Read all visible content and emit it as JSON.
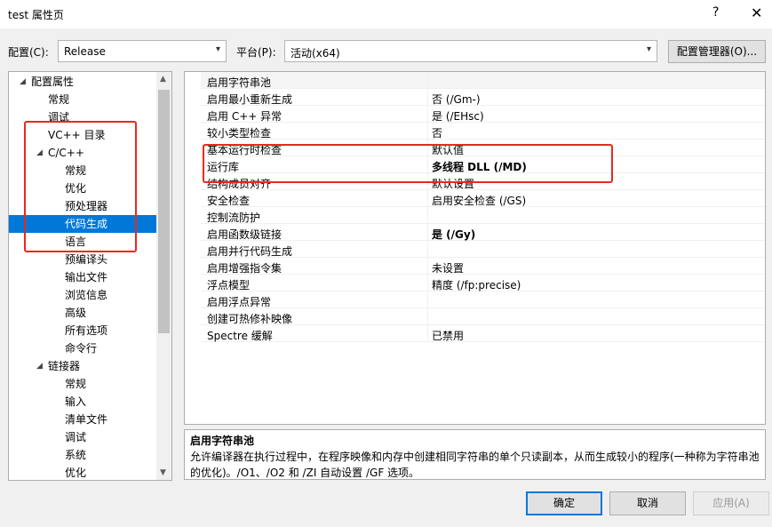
{
  "window": {
    "title": "test 属性页",
    "help_glyph": "?",
    "close_glyph": "✕"
  },
  "toolbar": {
    "config_label": "配置(C):",
    "config_value": "Release",
    "platform_label": "平台(P):",
    "platform_value": "活动(x64)",
    "config_manager_button": "配置管理器(O)..."
  },
  "tree": {
    "items": [
      {
        "label": "配置属性",
        "level": 0,
        "expander": "◢"
      },
      {
        "label": "常规",
        "level": 1
      },
      {
        "label": "调试",
        "level": 1
      },
      {
        "label": "VC++ 目录",
        "level": 1
      },
      {
        "label": "C/C++",
        "level": 1,
        "expander": "◢"
      },
      {
        "label": "常规",
        "level": 2
      },
      {
        "label": "优化",
        "level": 2
      },
      {
        "label": "预处理器",
        "level": 2
      },
      {
        "label": "代码生成",
        "level": 2,
        "selected": true
      },
      {
        "label": "语言",
        "level": 2
      },
      {
        "label": "预编译头",
        "level": 2
      },
      {
        "label": "输出文件",
        "level": 2
      },
      {
        "label": "浏览信息",
        "level": 2
      },
      {
        "label": "高级",
        "level": 2
      },
      {
        "label": "所有选项",
        "level": 2
      },
      {
        "label": "命令行",
        "level": 2
      },
      {
        "label": "链接器",
        "level": 1,
        "expander": "◢"
      },
      {
        "label": "常规",
        "level": 2
      },
      {
        "label": "输入",
        "level": 2
      },
      {
        "label": "清单文件",
        "level": 2
      },
      {
        "label": "调试",
        "level": 2
      },
      {
        "label": "系统",
        "level": 2
      },
      {
        "label": "优化",
        "level": 2
      }
    ]
  },
  "grid": {
    "rows": [
      {
        "name": "启用字符串池",
        "value": ""
      },
      {
        "name": "启用最小重新生成",
        "value": "否 (/Gm-)"
      },
      {
        "name": "启用 C++ 异常",
        "value": "是 (/EHsc)"
      },
      {
        "name": "较小类型检查",
        "value": "否"
      },
      {
        "name": "基本运行时检查",
        "value": "默认值"
      },
      {
        "name": "运行库",
        "value": "多线程 DLL (/MD)",
        "bold": true
      },
      {
        "name": "结构成员对齐",
        "value": "默认设置"
      },
      {
        "name": "安全检查",
        "value": "启用安全检查 (/GS)"
      },
      {
        "name": "控制流防护",
        "value": ""
      },
      {
        "name": "启用函数级链接",
        "value": "是 (/Gy)",
        "bold": true
      },
      {
        "name": "启用并行代码生成",
        "value": ""
      },
      {
        "name": "启用增强指令集",
        "value": "未设置"
      },
      {
        "name": "浮点模型",
        "value": "精度 (/fp:precise)"
      },
      {
        "name": "启用浮点异常",
        "value": ""
      },
      {
        "name": "创建可热修补映像",
        "value": ""
      },
      {
        "name": "Spectre 缓解",
        "value": "已禁用"
      }
    ]
  },
  "description": {
    "title": "启用字符串池",
    "text": "允许编译器在执行过程中，在程序映像和内存中创建相同字符串的单个只读副本，从而生成较小的程序(一种称为字符串池的优化)。/O1、/O2 和 /ZI 自动设置 /GF 选项。"
  },
  "buttons": {
    "ok": "确定",
    "cancel": "取消",
    "apply": "应用(A)"
  },
  "colors": {
    "selection": "#0078d7",
    "annotation": "#e8291f"
  }
}
